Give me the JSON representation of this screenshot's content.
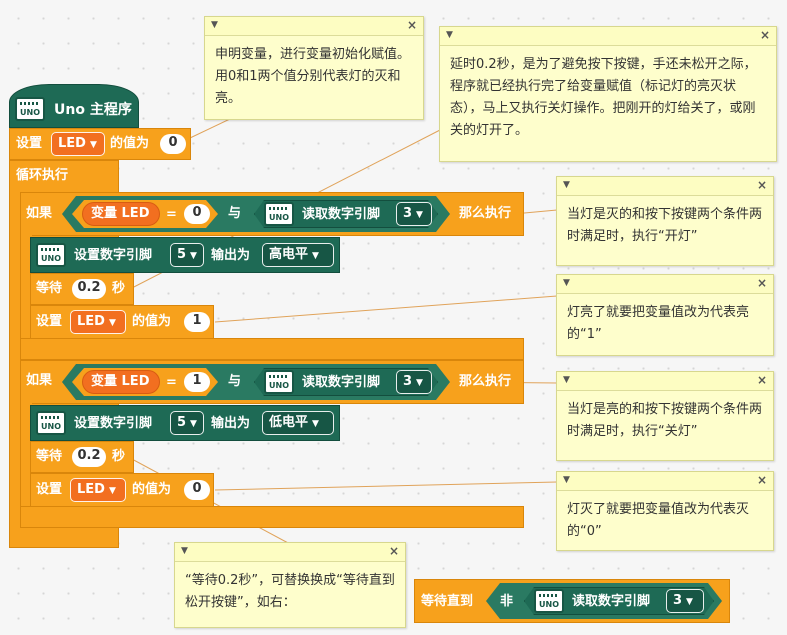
{
  "program": {
    "title": "Uno 主程序",
    "init": {
      "set_label": "设置",
      "var": "LED",
      "value_label": "的值为",
      "value": "0"
    },
    "loop_label": "循环执行",
    "if_blocks": [
      {
        "if_label": "如果",
        "var_label": "变量 LED",
        "op": "=",
        "compare": "0",
        "and_label": "与",
        "read_label": "读取数字引脚",
        "read_pin": "3",
        "then_label": "那么执行",
        "write_label": "设置数字引脚",
        "write_pin": "5",
        "output_label": "输出为",
        "level": "高电平",
        "wait_label": "等待",
        "wait_value": "0.2",
        "wait_unit": "秒",
        "set_label": "设置",
        "set_var": "LED",
        "set_value_label": "的值为",
        "set_value": "1"
      },
      {
        "if_label": "如果",
        "var_label": "变量 LED",
        "op": "=",
        "compare": "1",
        "and_label": "与",
        "read_label": "读取数字引脚",
        "read_pin": "3",
        "then_label": "那么执行",
        "write_label": "设置数字引脚",
        "write_pin": "5",
        "output_label": "输出为",
        "level": "低电平",
        "wait_label": "等待",
        "wait_value": "0.2",
        "wait_unit": "秒",
        "set_label": "设置",
        "set_var": "LED",
        "set_value_label": "的值为",
        "set_value": "0"
      }
    ]
  },
  "uno_icon_text": "UNO",
  "wait_until": {
    "label": "等待直到",
    "not_label": "非",
    "read_label": "读取数字引脚",
    "pin": "3"
  },
  "notes": [
    {
      "id": "declare",
      "text": "申明变量，进行变量初始化赋值。用0和1两个值分别代表灯的灭和亮。"
    },
    {
      "id": "delay",
      "text": "延时0.2秒，是为了避免按下按键，手还未松开之际，程序就已经执行完了给变量赋值（标记灯的亮灭状态），马上又执行关灯操作。把刚开的灯给关了，或刚关的灯开了。"
    },
    {
      "id": "light-off-cond",
      "text": "当灯是灭的和按下按键两个条件两时满足时，执行“开灯”"
    },
    {
      "id": "set-1",
      "text": "灯亮了就要把变量值改为代表亮的“1”"
    },
    {
      "id": "light-on-cond",
      "text": "当灯是亮的和按下按键两个条件两时满足时，执行“关灯”"
    },
    {
      "id": "set-0",
      "text": "灯灭了就要把变量值改为代表灭的“0”"
    },
    {
      "id": "replace",
      "text": "“等待0.2秒”，可替换换成“等待直到松开按键”，如右："
    }
  ],
  "icons": {
    "collapse": "chevron-down-icon",
    "close": "close-icon"
  }
}
